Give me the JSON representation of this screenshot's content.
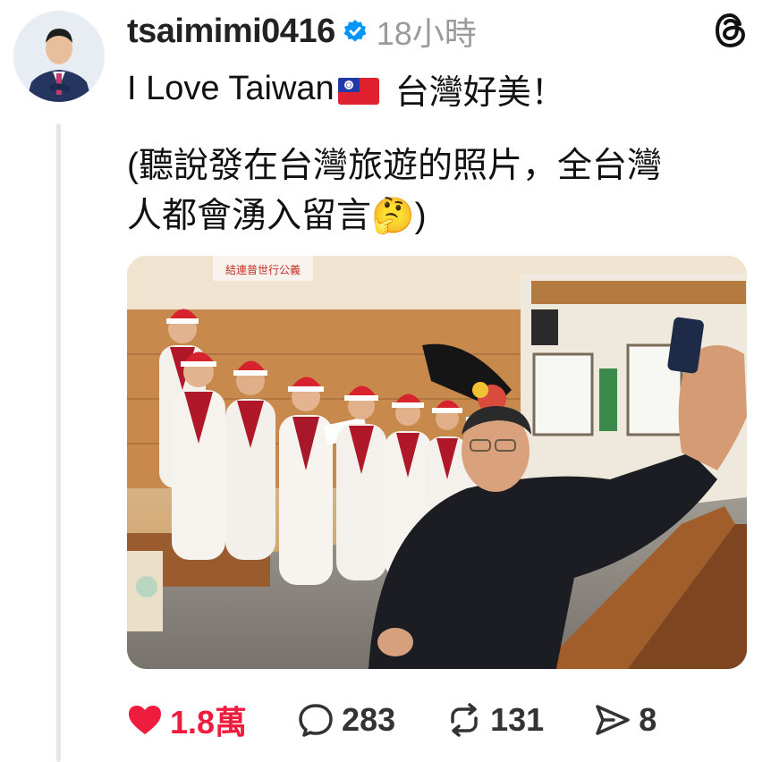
{
  "post": {
    "username": "tsaimimi0416",
    "time": "18小時",
    "title_text": "I Love Taiwan",
    "title_suffix": "台灣好美！",
    "body_line1": "(聽說發在台灣旅遊的照片，全台灣",
    "body_line2": "人都會湧入留言",
    "body_emoji": "🤔",
    "body_close": ")",
    "banner_text": "結連普世行公義"
  },
  "actions": {
    "likes": "1.8萬",
    "comments": "283",
    "reposts": "131",
    "shares": "8"
  },
  "colors": {
    "like": "#ee1d3e",
    "verified": "#0095f6",
    "muted": "#9a9a9a"
  },
  "icons": [
    "verified-badge-icon",
    "threads-logo-icon",
    "heart-icon",
    "comment-icon",
    "repost-icon",
    "share-icon"
  ]
}
